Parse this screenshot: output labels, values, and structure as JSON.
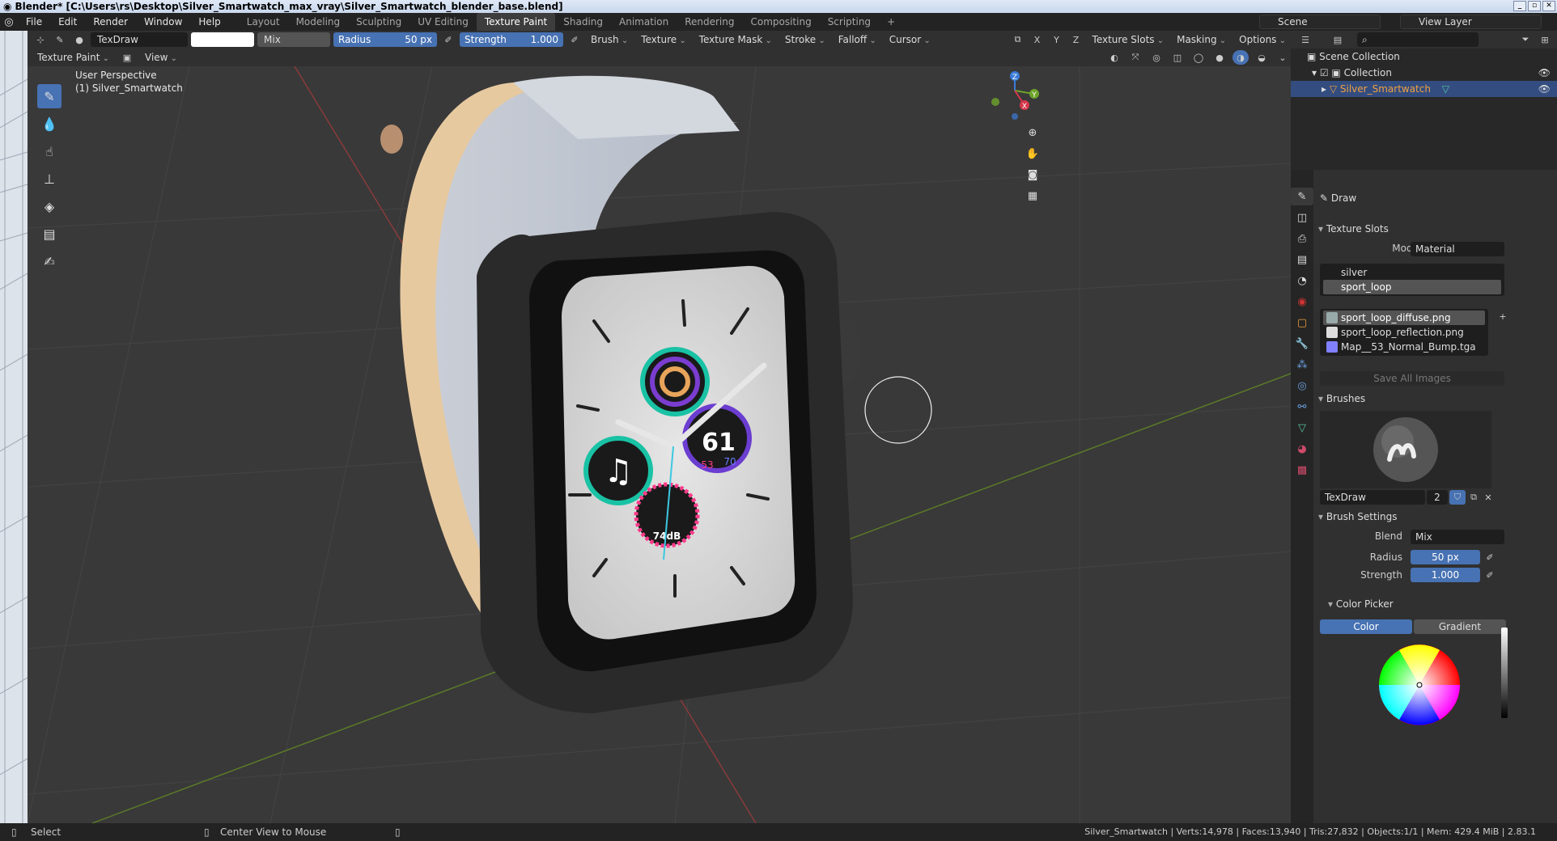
{
  "window": {
    "title": "Blender* [C:\\Users\\rs\\Desktop\\Silver_Smartwatch_max_vray\\Silver_Smartwatch_blender_base.blend]"
  },
  "menu": [
    "File",
    "Edit",
    "Render",
    "Window",
    "Help"
  ],
  "workspaces": [
    "Layout",
    "Modeling",
    "Sculpting",
    "UV Editing",
    "Texture Paint",
    "Shading",
    "Animation",
    "Rendering",
    "Compositing",
    "Scripting"
  ],
  "active_workspace": "Texture Paint",
  "scene": {
    "name": "Scene",
    "view_layer": "View Layer"
  },
  "toolbar": {
    "brush_name": "TexDraw",
    "blend_mode": "Mix",
    "radius_label": "Radius",
    "radius_value": "50 px",
    "strength_label": "Strength",
    "strength_value": "1.000",
    "menus": [
      "Brush",
      "Texture",
      "Texture Mask",
      "Stroke",
      "Falloff",
      "Cursor"
    ],
    "axes": [
      "X",
      "Y",
      "Z"
    ],
    "right_menus": [
      "Texture Slots",
      "Masking",
      "Options"
    ]
  },
  "header2": {
    "mode": "Texture Paint",
    "view": "View"
  },
  "viewport": {
    "perspective": "User Perspective",
    "object": "(1) Silver_Smartwatch",
    "watch": {
      "big_number": "61",
      "small_left": "53",
      "small_right": "70",
      "noise": "74dB"
    },
    "gizmo": {
      "z": "Z",
      "y": "Y",
      "x": "X"
    }
  },
  "outliner": {
    "rows": [
      {
        "label": "Scene Collection",
        "indent": 0
      },
      {
        "label": "Collection",
        "indent": 1
      },
      {
        "label": "Silver_Smartwatch",
        "indent": 2,
        "selected": true
      }
    ]
  },
  "properties": {
    "tool_name": "Draw",
    "texture_slots": {
      "title": "Texture Slots",
      "mode_label": "Mode",
      "mode_value": "Material",
      "materials": [
        "silver",
        "sport_loop"
      ],
      "selected_material": "sport_loop",
      "images": [
        "sport_loop_diffuse.png",
        "sport_loop_reflection.png",
        "Map__53_Normal_Bump.tga"
      ],
      "selected_image": "sport_loop_diffuse.png",
      "save_all": "Save All Images"
    },
    "brushes": {
      "title": "Brushes",
      "name": "TexDraw",
      "users": "2"
    },
    "brush_settings": {
      "title": "Brush Settings",
      "blend_label": "Blend",
      "blend_value": "Mix",
      "radius_label": "Radius",
      "radius_value": "50 px",
      "strength_label": "Strength",
      "strength_value": "1.000"
    },
    "color_picker": {
      "title": "Color Picker",
      "tabs": [
        "Color",
        "Gradient"
      ],
      "active_tab": "Color"
    }
  },
  "statusbar": {
    "left": "Select",
    "middle": "Center View to Mouse",
    "stats": "Silver_Smartwatch | Verts:14,978 | Faces:13,940 | Tris:27,832 | Objects:1/1 | Mem: 429.4 MiB | 2.83.1"
  },
  "colors": {
    "accent_blue": "#4772b3",
    "selected_row": "#334d80",
    "panel_bg": "#303030",
    "viewport_bg": "#393939"
  }
}
